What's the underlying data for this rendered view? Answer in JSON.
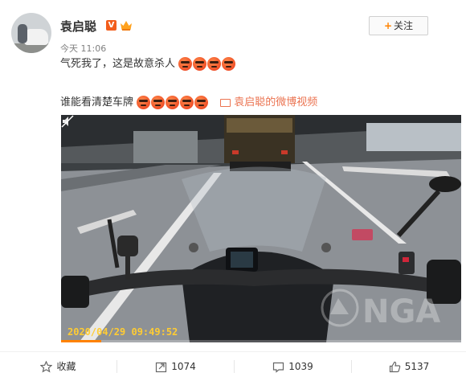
{
  "user": {
    "name": "袁启聪",
    "vip_badge": "V"
  },
  "follow_button": {
    "label": "关注"
  },
  "post": {
    "time": "今天 11:06",
    "line1_text": "气死我了，这是故意杀人",
    "line2_text": "谁能看清楚车牌",
    "video_link_label": "袁启聪的微博视频"
  },
  "video": {
    "timestamp": "2020/04/29  09:49:52",
    "watermark": "NGA",
    "progress": 0.1
  },
  "actions": {
    "favorite_label": "收藏",
    "repost_count": "1074",
    "comment_count": "1039",
    "like_count": "5137"
  },
  "colors": {
    "accent": "#ff8200",
    "link": "#eb7350"
  }
}
